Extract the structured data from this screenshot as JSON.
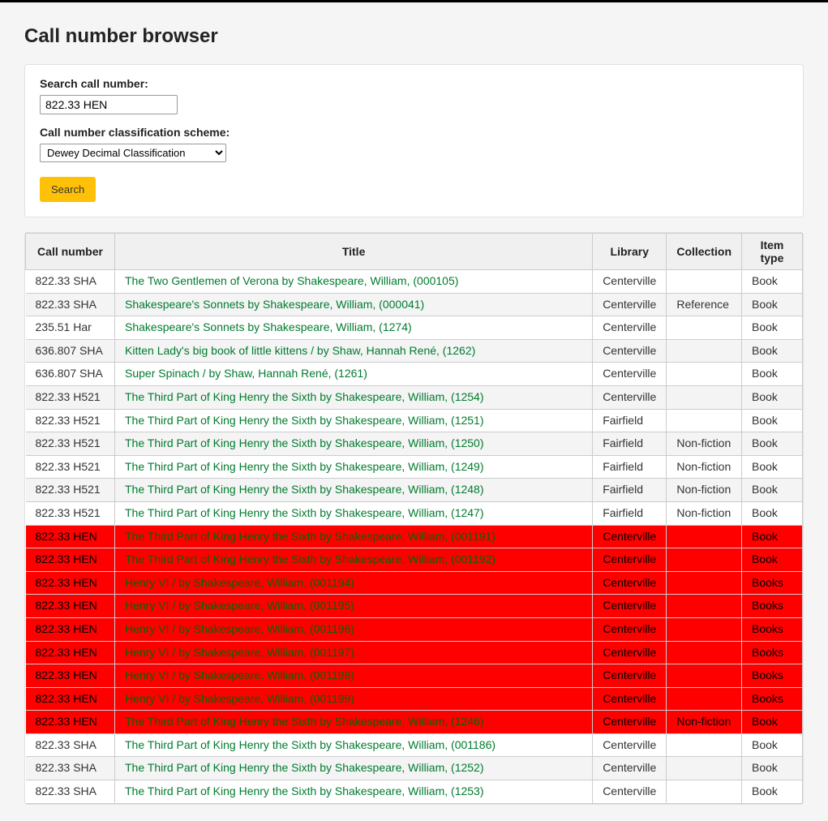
{
  "page": {
    "title": "Call number browser"
  },
  "form": {
    "search_label": "Search call number:",
    "search_value": "822.33 HEN",
    "scheme_label": "Call number classification scheme:",
    "scheme_value": "Dewey Decimal Classification",
    "submit_label": "Search"
  },
  "table": {
    "headers": {
      "callno": "Call number",
      "title": "Title",
      "library": "Library",
      "collection": "Collection",
      "itemtype": "Item type"
    },
    "rows": [
      {
        "callno": "822.33 SHA",
        "title": "The Two Gentlemen of Verona by Shakespeare, William, (000105)",
        "library": "Centerville",
        "collection": "",
        "itemtype": "Book",
        "hl": false
      },
      {
        "callno": "822.33 SHA",
        "title": "Shakespeare's Sonnets by Shakespeare, William, (000041)",
        "library": "Centerville",
        "collection": "Reference",
        "itemtype": "Book",
        "hl": false
      },
      {
        "callno": "235.51 Har",
        "title": "Shakespeare's Sonnets by Shakespeare, William, (1274)",
        "library": "Centerville",
        "collection": "",
        "itemtype": "Book",
        "hl": false
      },
      {
        "callno": "636.807 SHA",
        "title": "Kitten Lady's big book of little kittens / by Shaw, Hannah René, (1262)",
        "library": "Centerville",
        "collection": "",
        "itemtype": "Book",
        "hl": false
      },
      {
        "callno": "636.807 SHA",
        "title": "Super Spinach / by Shaw, Hannah René, (1261)",
        "library": "Centerville",
        "collection": "",
        "itemtype": "Book",
        "hl": false
      },
      {
        "callno": "822.33 H521",
        "title": "The Third Part of King Henry the Sixth by Shakespeare, William, (1254)",
        "library": "Centerville",
        "collection": "",
        "itemtype": "Book",
        "hl": false
      },
      {
        "callno": "822.33 H521",
        "title": "The Third Part of King Henry the Sixth by Shakespeare, William, (1251)",
        "library": "Fairfield",
        "collection": "",
        "itemtype": "Book",
        "hl": false
      },
      {
        "callno": "822.33 H521",
        "title": "The Third Part of King Henry the Sixth by Shakespeare, William, (1250)",
        "library": "Fairfield",
        "collection": "Non-fiction",
        "itemtype": "Book",
        "hl": false
      },
      {
        "callno": "822.33 H521",
        "title": "The Third Part of King Henry the Sixth by Shakespeare, William, (1249)",
        "library": "Fairfield",
        "collection": "Non-fiction",
        "itemtype": "Book",
        "hl": false
      },
      {
        "callno": "822.33 H521",
        "title": "The Third Part of King Henry the Sixth by Shakespeare, William, (1248)",
        "library": "Fairfield",
        "collection": "Non-fiction",
        "itemtype": "Book",
        "hl": false
      },
      {
        "callno": "822.33 H521",
        "title": "The Third Part of King Henry the Sixth by Shakespeare, William, (1247)",
        "library": "Fairfield",
        "collection": "Non-fiction",
        "itemtype": "Book",
        "hl": false
      },
      {
        "callno": "822.33 HEN",
        "title": "The Third Part of King Henry the Sixth by Shakespeare, William, (001191)",
        "library": "Centerville",
        "collection": "",
        "itemtype": "Book",
        "hl": true
      },
      {
        "callno": "822.33 HEN",
        "title": "The Third Part of King Henry the Sixth by Shakespeare, William, (001192)",
        "library": "Centerville",
        "collection": "",
        "itemtype": "Book",
        "hl": true
      },
      {
        "callno": "822.33 HEN",
        "title": "Henry VI / by Shakespeare, William, (001194)",
        "library": "Centerville",
        "collection": "",
        "itemtype": "Books",
        "hl": true
      },
      {
        "callno": "822.33 HEN",
        "title": "Henry VI / by Shakespeare, William, (001195)",
        "library": "Centerville",
        "collection": "",
        "itemtype": "Books",
        "hl": true
      },
      {
        "callno": "822.33 HEN",
        "title": "Henry VI / by Shakespeare, William, (001196)",
        "library": "Centerville",
        "collection": "",
        "itemtype": "Books",
        "hl": true
      },
      {
        "callno": "822.33 HEN",
        "title": "Henry VI / by Shakespeare, William, (001197)",
        "library": "Centerville",
        "collection": "",
        "itemtype": "Books",
        "hl": true
      },
      {
        "callno": "822.33 HEN",
        "title": "Henry VI / by Shakespeare, William, (001198)",
        "library": "Centerville",
        "collection": "",
        "itemtype": "Books",
        "hl": true
      },
      {
        "callno": "822.33 HEN",
        "title": "Henry VI / by Shakespeare, William, (001199)",
        "library": "Centerville",
        "collection": "",
        "itemtype": "Books",
        "hl": true
      },
      {
        "callno": "822.33 HEN",
        "title": "The Third Part of King Henry the Sixth by Shakespeare, William, (1246)",
        "library": "Centerville",
        "collection": "Non-fiction",
        "itemtype": "Book",
        "hl": true
      },
      {
        "callno": "822.33 SHA",
        "title": "The Third Part of King Henry the Sixth by Shakespeare, William, (001186)",
        "library": "Centerville",
        "collection": "",
        "itemtype": "Book",
        "hl": false
      },
      {
        "callno": "822.33 SHA",
        "title": "The Third Part of King Henry the Sixth by Shakespeare, William, (1252)",
        "library": "Centerville",
        "collection": "",
        "itemtype": "Book",
        "hl": false
      },
      {
        "callno": "822.33 SHA",
        "title": "The Third Part of King Henry the Sixth by Shakespeare, William, (1253)",
        "library": "Centerville",
        "collection": "",
        "itemtype": "Book",
        "hl": false
      }
    ]
  }
}
